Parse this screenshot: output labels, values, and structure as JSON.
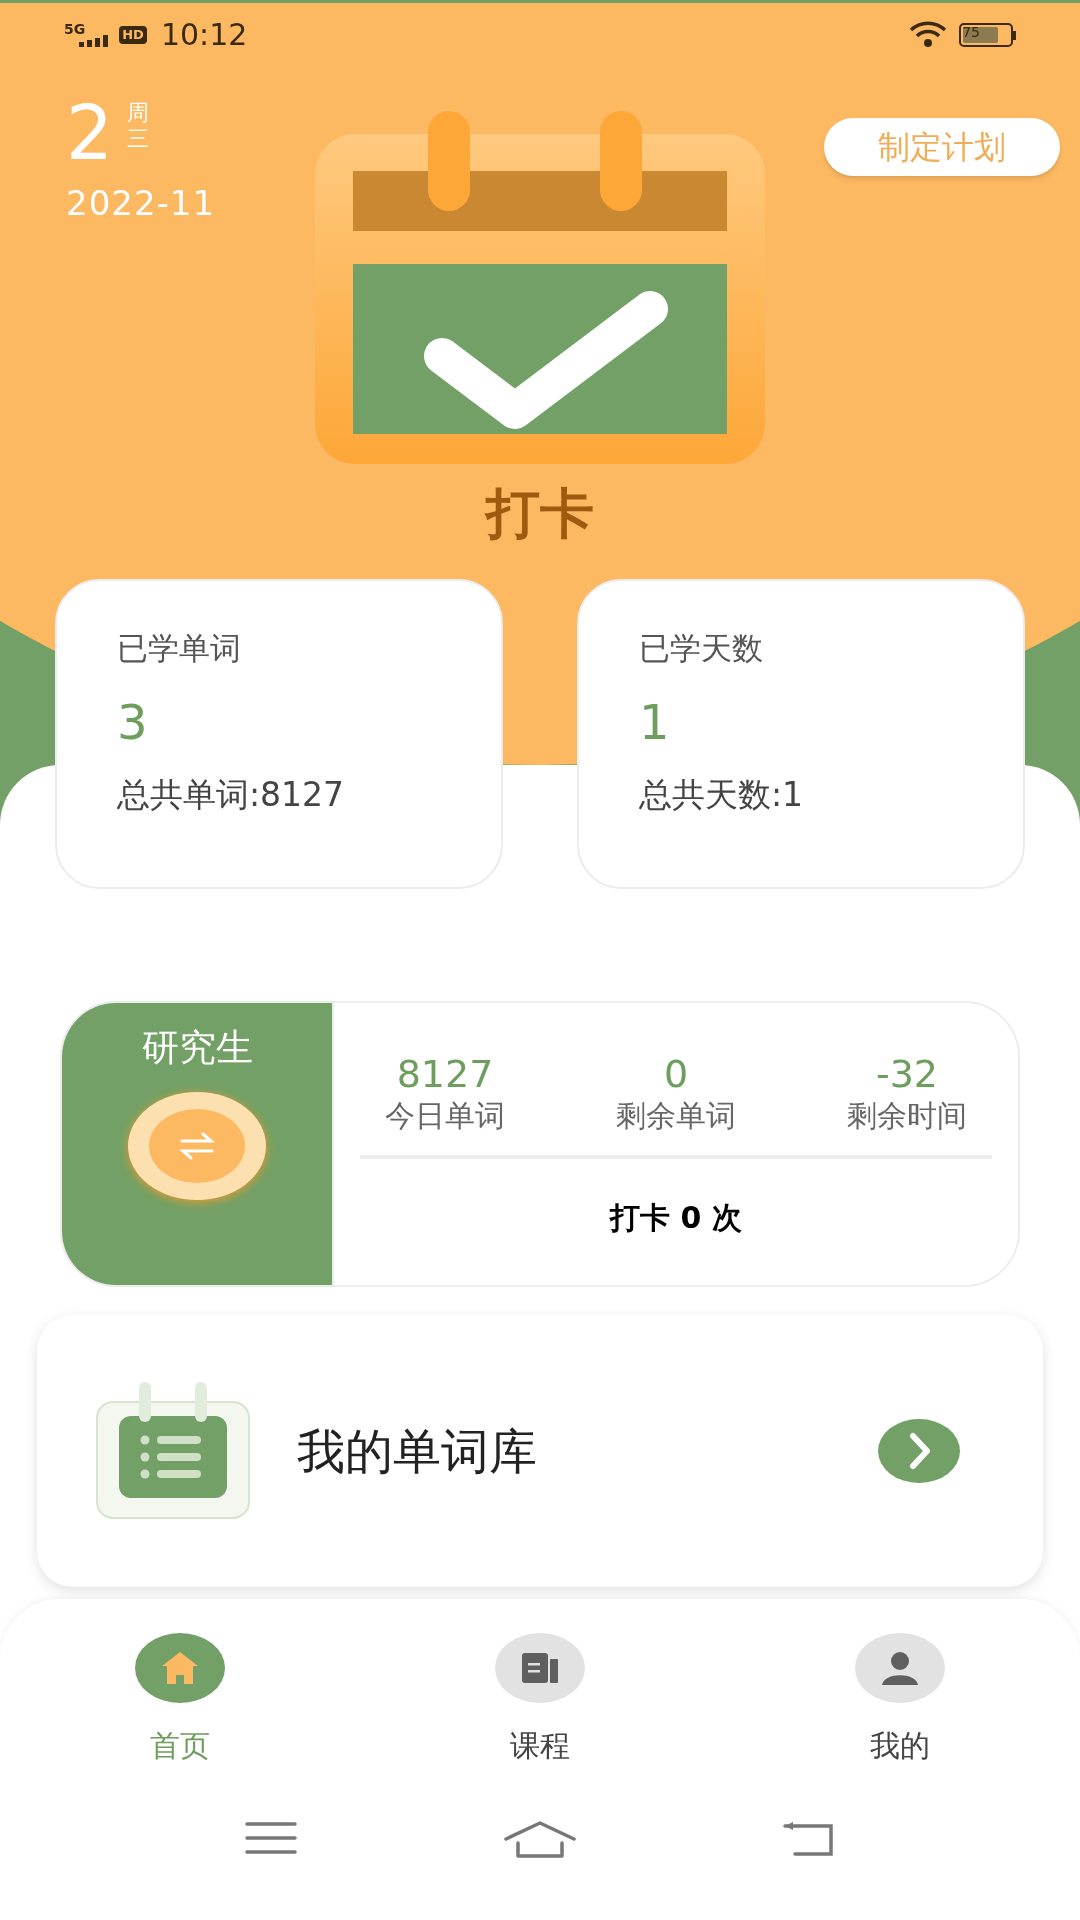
{
  "status_bar": {
    "network": "5G",
    "hd": "HD",
    "time": "10:12",
    "battery": "75"
  },
  "date": {
    "day": "2",
    "weekday_label": "周",
    "weekday": "三",
    "month": "2022-11"
  },
  "plan_button": "制定计划",
  "checkin_title": "打卡",
  "stats": [
    {
      "label": "已学单词",
      "value": "3",
      "total": "总共单词:8127"
    },
    {
      "label": "已学天数",
      "value": "1",
      "total": "总共天数:1"
    }
  ],
  "level_panel": {
    "level": "研究生",
    "metrics": [
      {
        "value": "8127",
        "label": "今日单词"
      },
      {
        "value": "0",
        "label": "剩余单词"
      },
      {
        "value": "-32",
        "label": "剩余时间"
      }
    ],
    "checkins": "打卡 0 次"
  },
  "word_library": {
    "title": "我的单词库"
  },
  "tabs": [
    {
      "label": "首页",
      "selected": true,
      "kind": "home"
    },
    {
      "label": "课程",
      "selected": false,
      "kind": "course"
    },
    {
      "label": "我的",
      "selected": false,
      "kind": "profile"
    }
  ]
}
